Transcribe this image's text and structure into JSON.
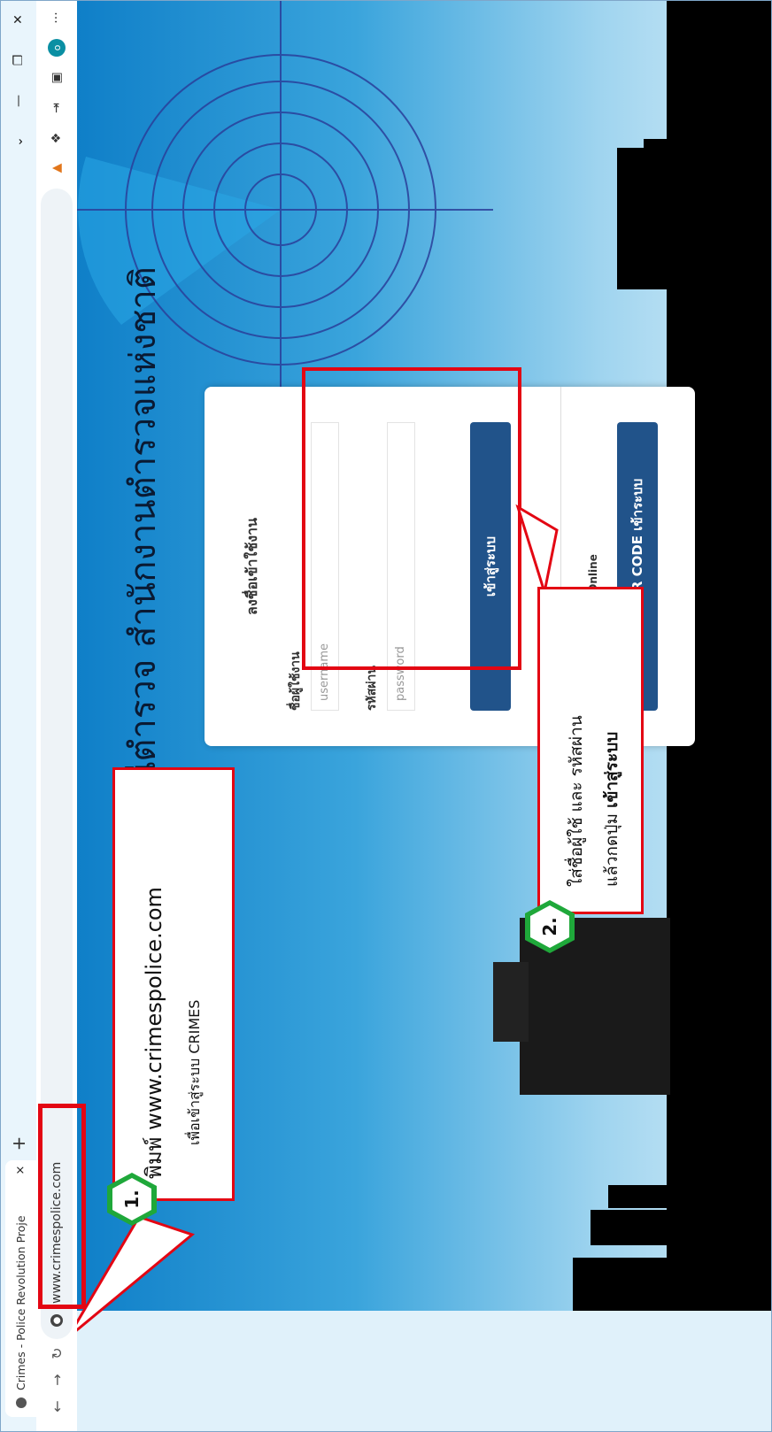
{
  "browser": {
    "tab_title": "Crimes - Police Revolution Proje",
    "tab_close": "×",
    "new_tab": "+",
    "url": "www.crimespolice.com",
    "profile_initial": "o",
    "menu": "···"
  },
  "page": {
    "heading": "สถานีตำรวจ  สำนักงานตำรวจแห่งชาติ",
    "login": {
      "title": "ลงชื่อเข้าใช้งาน",
      "username_label": "ชื่อผู้ใช้งาน",
      "username_placeholder": "username",
      "password_label": "รหัสผ่าน",
      "password_placeholder": "password",
      "submit": "เข้าสู่ระบบ",
      "qr_note": "สำหรับผู้มีสิทธิ์ CRIMES Online",
      "qr_button": "ผ่านทาง QR CODE เข้าระบบ"
    }
  },
  "annotations": {
    "step1_number": "1.",
    "step1_line1": "พิมพ์ www.crimespolice.com",
    "step1_line2": "เพื่อเข้าสู่ระบบ CRIMES",
    "step2_number": "2.",
    "step2_line1": "ใส่ชื่อผู้ใช้ และ รหัสผ่าน",
    "step2_line2_prefix": "แล้วกดปุ่ม ",
    "step2_line2_bold": "เข้าสู่ระบบ"
  }
}
